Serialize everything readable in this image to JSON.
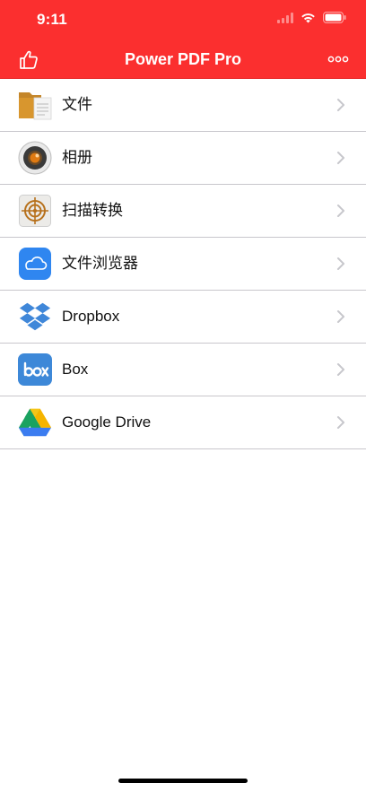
{
  "status_bar": {
    "time": "9:11"
  },
  "nav": {
    "title": "Power PDF Pro",
    "left_icon": "thumbs-up-icon",
    "right_icon": "more-icon"
  },
  "list": {
    "items": [
      {
        "label": "文件",
        "icon": "folder-icon"
      },
      {
        "label": "相册",
        "icon": "camera-icon"
      },
      {
        "label": "扫描转换",
        "icon": "scan-target-icon"
      },
      {
        "label": "文件浏览器",
        "icon": "icloud-icon"
      },
      {
        "label": "Dropbox",
        "icon": "dropbox-icon"
      },
      {
        "label": "Box",
        "icon": "box-icon"
      },
      {
        "label": "Google Drive",
        "icon": "google-drive-icon"
      }
    ]
  },
  "colors": {
    "accent": "#fb2f2f",
    "separator": "#c8c7cc",
    "chevron": "#c7c7cc"
  }
}
